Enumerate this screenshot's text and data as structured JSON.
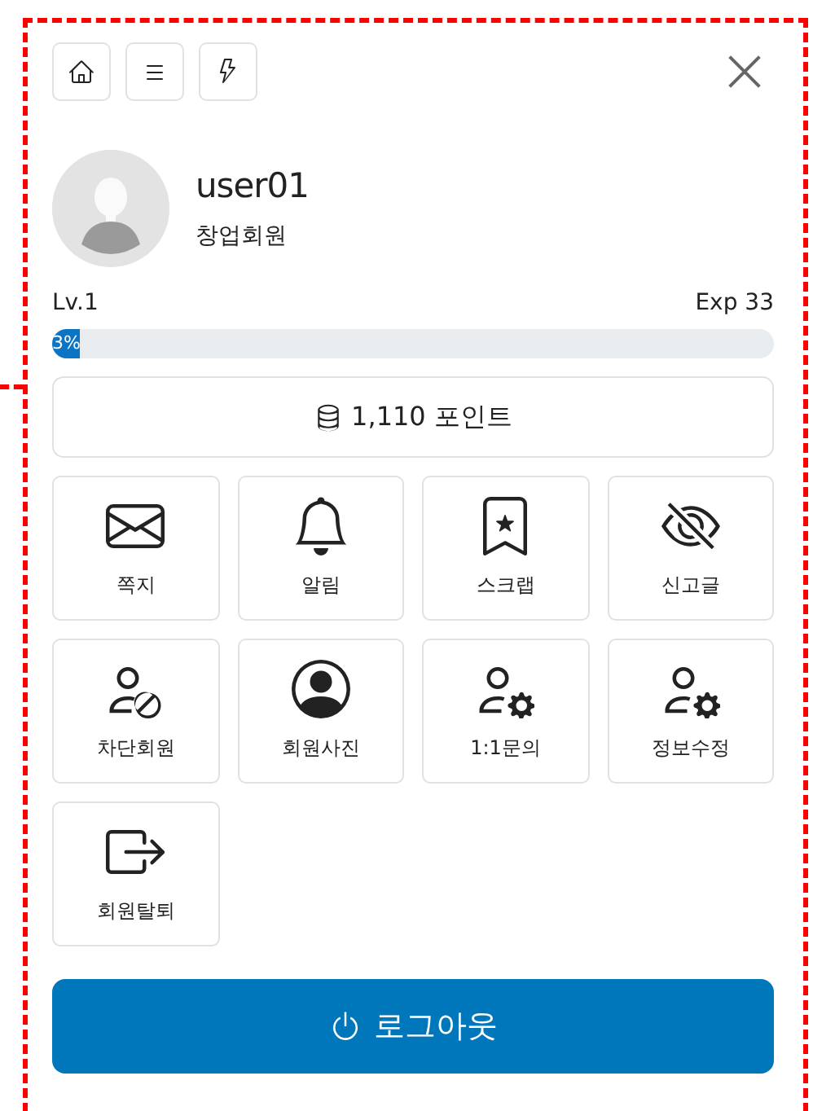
{
  "user": {
    "name": "user01",
    "rank": "창업회원"
  },
  "level": {
    "label": "Lv.1",
    "exp": "Exp 33",
    "progress_label": "3%",
    "level": 0.03
  },
  "points": {
    "label": "1,110 포인트"
  },
  "menu": [
    {
      "kind": "envelope",
      "label": "쪽지"
    },
    {
      "kind": "bell",
      "label": "알림"
    },
    {
      "kind": "bookmark",
      "label": "스크랩"
    },
    {
      "kind": "eye-slash",
      "label": "신고글"
    },
    {
      "kind": "person-slash",
      "label": "차단회원"
    },
    {
      "kind": "person-circle",
      "label": "회원사진"
    },
    {
      "kind": "person-gear",
      "label": "1:1문의"
    },
    {
      "kind": "person-gear",
      "label": "정보수정"
    },
    {
      "kind": "exit",
      "label": "회원탈퇴"
    }
  ],
  "logout": {
    "label": "로그아웃"
  }
}
